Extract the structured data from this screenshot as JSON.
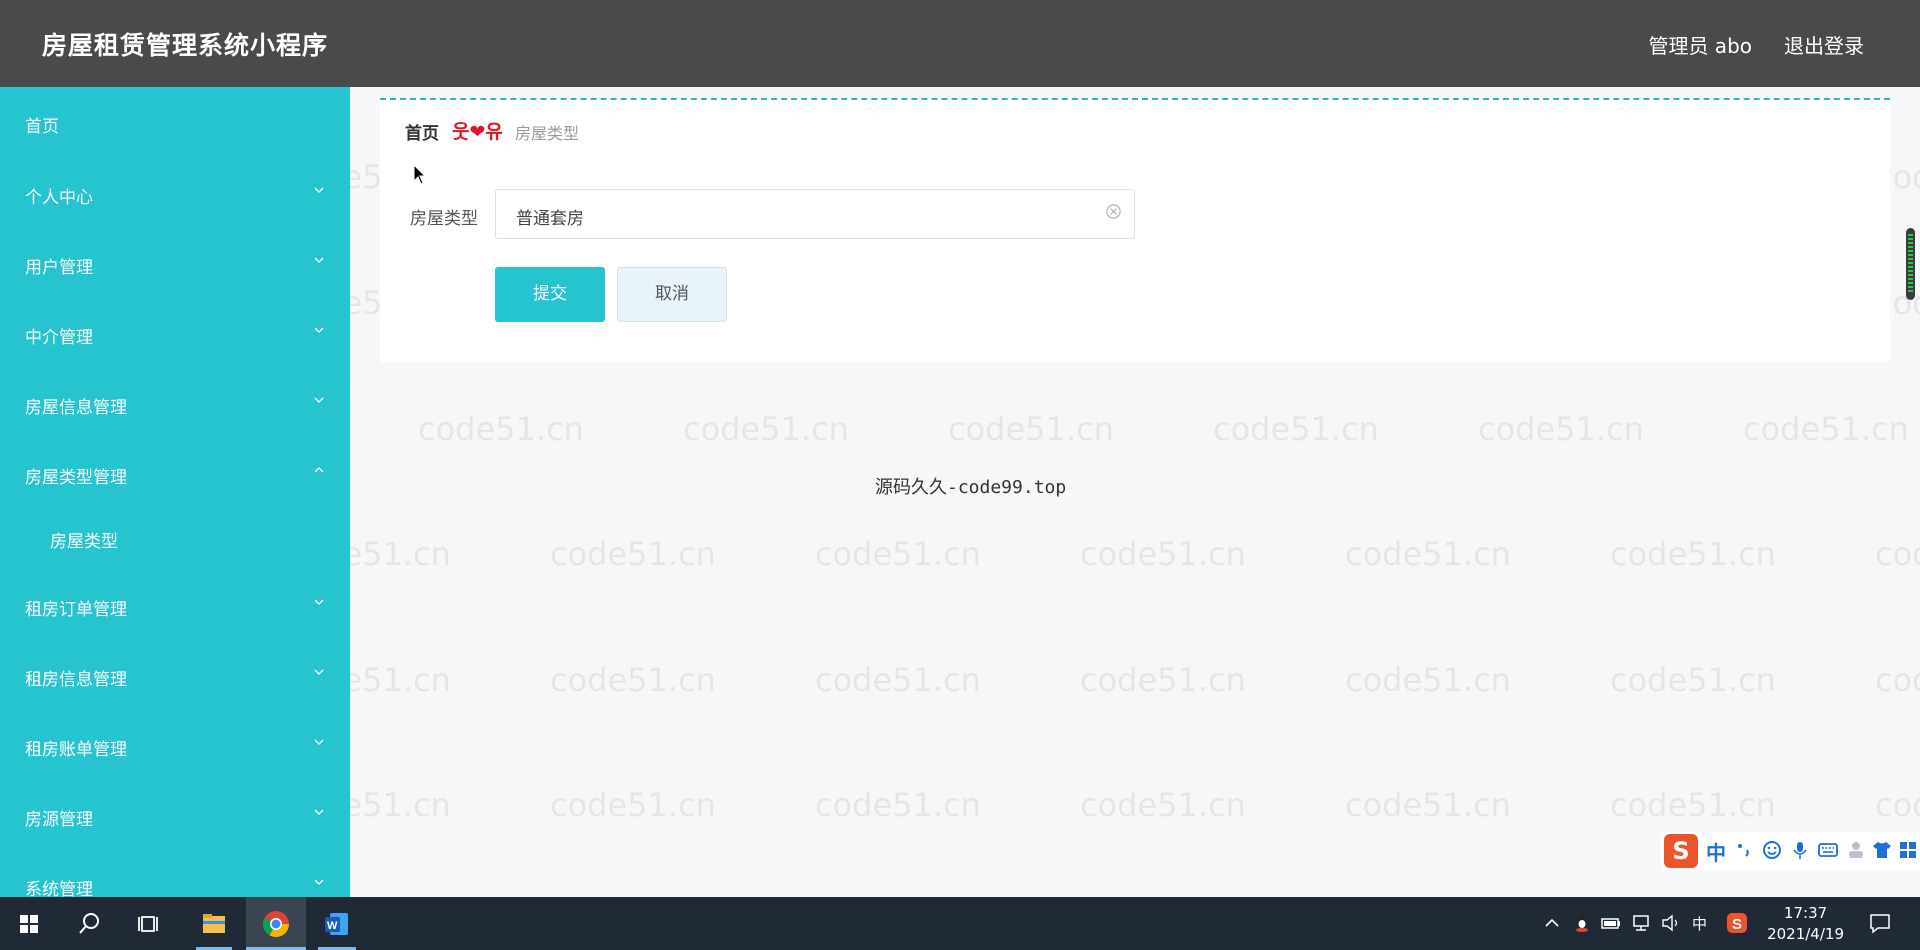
{
  "header": {
    "app_title": "房屋租赁管理系统小程序",
    "user_label": "管理员 abo",
    "logout_label": "退出登录"
  },
  "sidebar": {
    "items": [
      {
        "label": "首页",
        "expandable": false
      },
      {
        "label": "个人中心",
        "expandable": true,
        "expanded": false
      },
      {
        "label": "用户管理",
        "expandable": true,
        "expanded": false
      },
      {
        "label": "中介管理",
        "expandable": true,
        "expanded": false
      },
      {
        "label": "房屋信息管理",
        "expandable": true,
        "expanded": false
      },
      {
        "label": "房屋类型管理",
        "expandable": true,
        "expanded": true
      },
      {
        "label": "房屋类型",
        "submenu": true
      },
      {
        "label": "租房订单管理",
        "expandable": true,
        "expanded": false
      },
      {
        "label": "租房信息管理",
        "expandable": true,
        "expanded": false
      },
      {
        "label": "租房账单管理",
        "expandable": true,
        "expanded": false
      },
      {
        "label": "房源管理",
        "expandable": true,
        "expanded": false
      },
      {
        "label": "系统管理",
        "expandable": true,
        "expanded": false
      }
    ]
  },
  "breadcrumb": {
    "home": "首页",
    "separator": "웃❤유",
    "current": "房屋类型"
  },
  "form": {
    "field_label": "房屋类型",
    "field_value": "普通套房",
    "submit_label": "提交",
    "cancel_label": "取消"
  },
  "footer": {
    "text": "源码久久-code99.top"
  },
  "watermark": {
    "text": "code51.cn"
  },
  "ime": {
    "logo": "S",
    "mode": "中"
  },
  "taskbar": {
    "tray_ime": "中",
    "time": "17:37",
    "date": "2021/4/19"
  },
  "colors": {
    "header_bg": "#4a4a4a",
    "sidebar_bg": "#25c4cf",
    "accent": "#25c4cf",
    "breadcrumb_separator": "#e0152a"
  }
}
